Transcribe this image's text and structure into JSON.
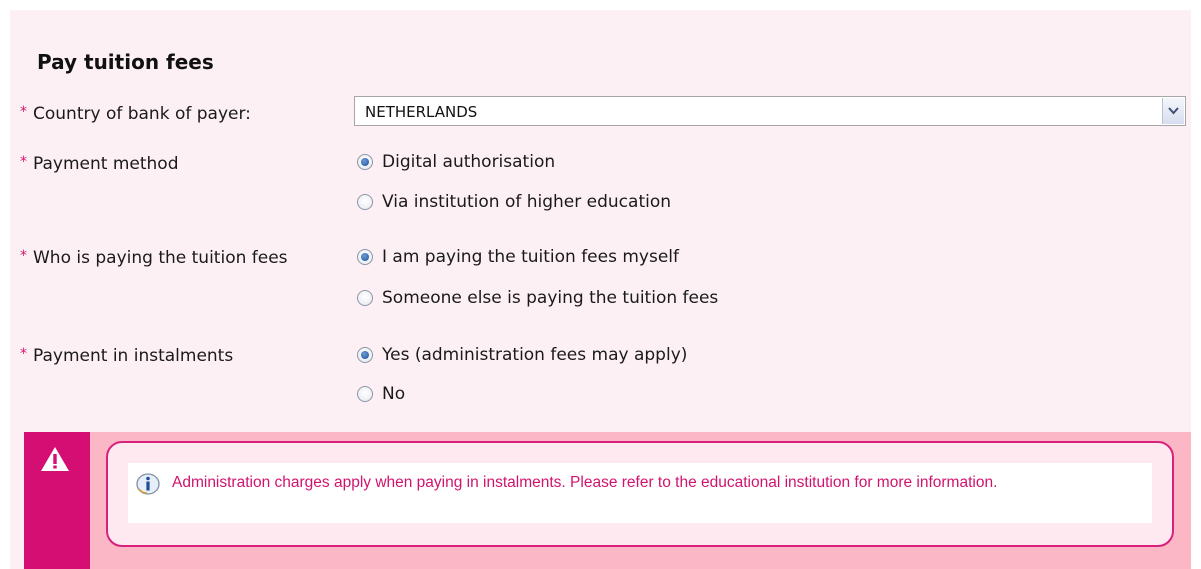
{
  "form": {
    "title": "Pay tuition fees",
    "required_marker": "*",
    "country": {
      "label": "Country of bank of payer:",
      "value": "NETHERLANDS"
    },
    "payment_method": {
      "label": "Payment method",
      "options": [
        "Digital authorisation",
        "Via institution of higher education"
      ],
      "selected": 0
    },
    "payer": {
      "label": "Who is paying the tuition fees",
      "options": [
        "I am paying the tuition fees myself",
        "Someone else is paying the tuition fees"
      ],
      "selected": 0
    },
    "instalments": {
      "label": "Payment in instalments",
      "options": [
        "Yes (administration fees may apply)",
        "No"
      ],
      "selected": 0
    }
  },
  "alert": {
    "icon": "warning-icon",
    "info_icon": "info-icon",
    "message": "Administration charges apply when paying in instalments. Please refer to the educational institution for more information."
  },
  "colors": {
    "accent": "#d0146e",
    "panel_bg": "#fdf0f4",
    "alert_bg": "#fbb7c6",
    "alert_stripe": "#d40e73"
  }
}
